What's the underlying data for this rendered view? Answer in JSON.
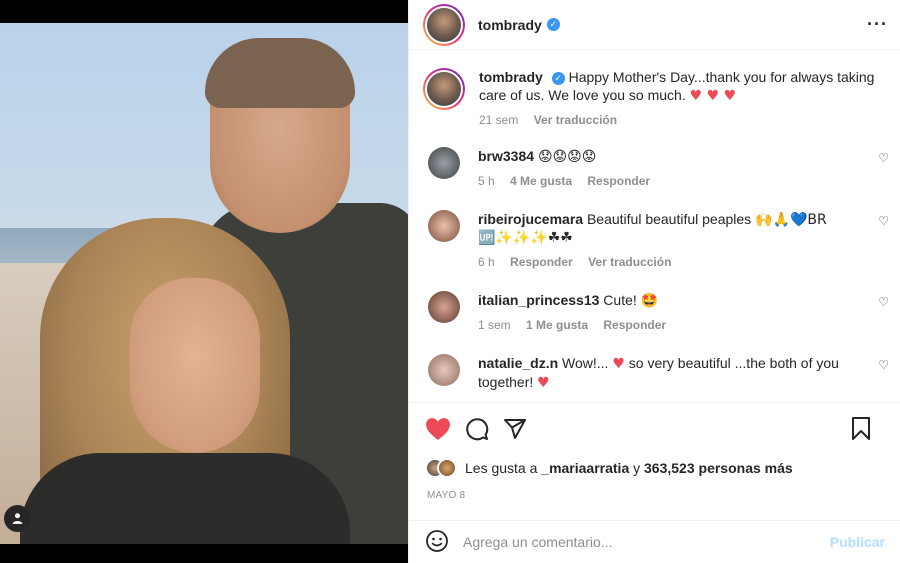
{
  "post": {
    "username": "tombrady",
    "caption": "Happy Mother's Day...thank you for always taking care of us. We love you so much.",
    "caption_emoji": "♥ ♥ ♥",
    "caption_time": "21 sem",
    "caption_translate": "Ver traducción"
  },
  "comments": [
    {
      "user": "brw3384",
      "text": "",
      "emoji": "😟😟😟😟",
      "time": "5 h",
      "likes": "4 Me gusta",
      "reply": "Responder",
      "translate": ""
    },
    {
      "user": "ribeirojucemara",
      "text": "Beautiful beautiful peaples",
      "emoji": "🙌🙏💙BR",
      "emoji2": "🆙✨✨✨☘☘",
      "time": "6 h",
      "likes": "",
      "reply": "Responder",
      "translate": "Ver traducción"
    },
    {
      "user": "italian_princess13",
      "text": "Cute!",
      "emoji": "🤩",
      "time": "1 sem",
      "likes": "1 Me gusta",
      "reply": "Responder",
      "translate": ""
    },
    {
      "user": "natalie_dz.n",
      "text": "Wow!...",
      "emoji": "♥",
      "text2": "so very beautiful ...the both of you together!",
      "emoji_end": "♥",
      "time": "",
      "likes": "",
      "reply": "",
      "translate": ""
    }
  ],
  "likes": {
    "prefix": "Les gusta a",
    "first_user": "_mariaarratia",
    "joiner": "y",
    "count": "363,523 personas más"
  },
  "date": "MAYO 8",
  "input": {
    "placeholder": "Agrega un comentario..."
  },
  "publish_label": "Publicar",
  "colors": {
    "like_red": "#ed4956",
    "verified_blue": "#3897f0",
    "publish_blue": "#b2dffc"
  }
}
